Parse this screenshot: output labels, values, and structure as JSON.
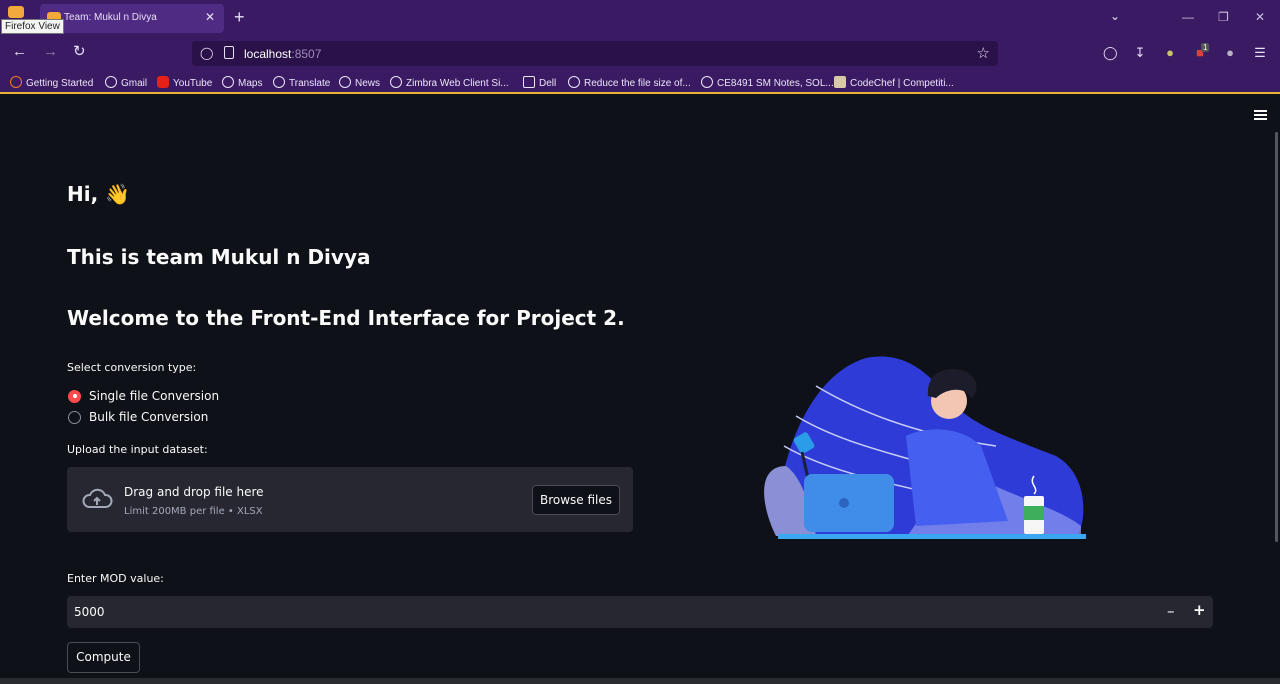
{
  "browser": {
    "tab_title": "Team: Mukul n Divya",
    "tooltip": "Firefox View",
    "url_host": "localhost",
    "url_port": ":8507",
    "new_tab": "+",
    "tab_close": "✕",
    "badge": "1",
    "bookmarks": [
      "Getting Started",
      "Gmail",
      "YouTube",
      "Maps",
      "Translate",
      "News",
      "Zimbra Web Client Si...",
      "Dell",
      "Reduce the file size of...",
      "CE8491 SM Notes, SOL...",
      "CodeChef | Competiti..."
    ]
  },
  "app": {
    "greeting": "Hi, 👋",
    "team": "This is team Mukul n Divya",
    "welcome": "Welcome to the Front-End Interface for Project 2.",
    "conversion_label": "Select conversion type:",
    "radio_options": [
      "Single file Conversion",
      "Bulk file Conversion"
    ],
    "selected_option": "Single file Conversion",
    "upload_label": "Upload the input dataset:",
    "dropzone_text": "Drag and drop file here",
    "dropzone_limit": "Limit 200MB per file • XLSX",
    "browse_label": "Browse files",
    "mod_label": "Enter MOD value:",
    "mod_value": "5000",
    "compute_label": "Compute"
  },
  "colors": {
    "browser_chrome": "#3a1a63",
    "app_background": "#0e1117",
    "widget_background": "#262730",
    "accent_radio": "#ff4b4b"
  }
}
